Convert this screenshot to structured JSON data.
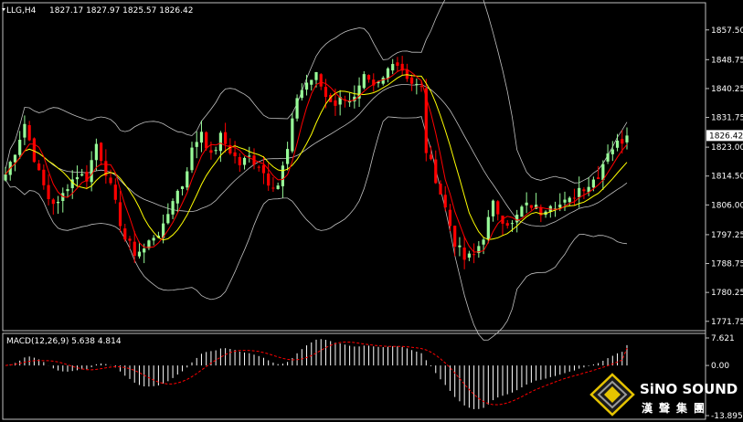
{
  "chart_data": [
    {
      "type": "candlestick",
      "title": "LLG,H4",
      "ohlc_info": "1827.17 1827.97 1825.57 1826.42",
      "last_price": 1826.42,
      "ylim": [
        1769.0,
        1865.5
      ],
      "y_ticks": [
        "1857.50",
        "1848.75",
        "1840.25",
        "1831.75",
        "1823.00",
        "1814.50",
        "1806.00",
        "1797.25",
        "1788.75",
        "1780.25",
        "1771.75"
      ],
      "y_tick_values": [
        1857.5,
        1848.75,
        1840.25,
        1831.75,
        1823.0,
        1814.5,
        1806.0,
        1797.25,
        1788.75,
        1780.25,
        1771.75
      ],
      "current_price_label": "1826.42",
      "colors": {
        "bull": "#98fb98",
        "bear": "#ff0000",
        "ma": "#ffff00",
        "signal_ma": "#ff0000",
        "bands": "#c0c0c0"
      },
      "path_points": [
        [
          0,
          1815
        ],
        [
          2,
          1822
        ],
        [
          4,
          1830
        ],
        [
          5,
          1825
        ],
        [
          7,
          1815
        ],
        [
          9,
          1808
        ],
        [
          11,
          1806
        ],
        [
          13,
          1812
        ],
        [
          15,
          1815
        ],
        [
          17,
          1814
        ],
        [
          19,
          1824
        ],
        [
          21,
          1816
        ],
        [
          23,
          1806
        ],
        [
          25,
          1796
        ],
        [
          27,
          1792
        ],
        [
          29,
          1793
        ],
        [
          31,
          1797
        ],
        [
          33,
          1799
        ],
        [
          35,
          1808
        ],
        [
          37,
          1812
        ],
        [
          39,
          1822
        ],
        [
          41,
          1828
        ],
        [
          43,
          1820
        ],
        [
          45,
          1826
        ],
        [
          47,
          1822
        ],
        [
          49,
          1818
        ],
        [
          51,
          1820
        ],
        [
          53,
          1818
        ],
        [
          55,
          1813
        ],
        [
          57,
          1812
        ],
        [
          59,
          1822
        ],
        [
          61,
          1838
        ],
        [
          63,
          1842
        ],
        [
          65,
          1844
        ],
        [
          67,
          1838
        ],
        [
          69,
          1836
        ],
        [
          71,
          1838
        ],
        [
          73,
          1837
        ],
        [
          75,
          1843
        ],
        [
          77,
          1840
        ],
        [
          79,
          1843
        ],
        [
          81,
          1849
        ],
        [
          83,
          1846
        ],
        [
          85,
          1842
        ],
        [
          87,
          1840
        ],
        [
          88,
          1822
        ],
        [
          90,
          1814
        ],
        [
          92,
          1805
        ],
        [
          94,
          1795
        ],
        [
          96,
          1790
        ],
        [
          98,
          1791
        ],
        [
          100,
          1797
        ],
        [
          102,
          1806
        ],
        [
          104,
          1802
        ],
        [
          106,
          1800
        ],
        [
          108,
          1805
        ],
        [
          110,
          1806
        ],
        [
          112,
          1804
        ],
        [
          114,
          1807
        ],
        [
          116,
          1806
        ],
        [
          118,
          1807
        ],
        [
          120,
          1811
        ],
        [
          122,
          1812
        ],
        [
          124,
          1815
        ],
        [
          126,
          1822
        ],
        [
          128,
          1824
        ],
        [
          130,
          1826.4
        ]
      ],
      "candle_count": 131,
      "macd": {
        "label": "MACD(12,26,9) 5.638 4.814",
        "params": [
          12,
          26,
          9
        ],
        "macd": 5.638,
        "signal": 4.814,
        "ylim": [
          -13.895,
          7.621
        ],
        "y_ticks": [
          "7.621",
          "0.00",
          "-13.895"
        ],
        "y_tick_values": [
          7.621,
          0.0,
          -13.895
        ]
      }
    }
  ],
  "logo": {
    "text": "SiNO SOUND",
    "subtext": "漢聲集團"
  }
}
